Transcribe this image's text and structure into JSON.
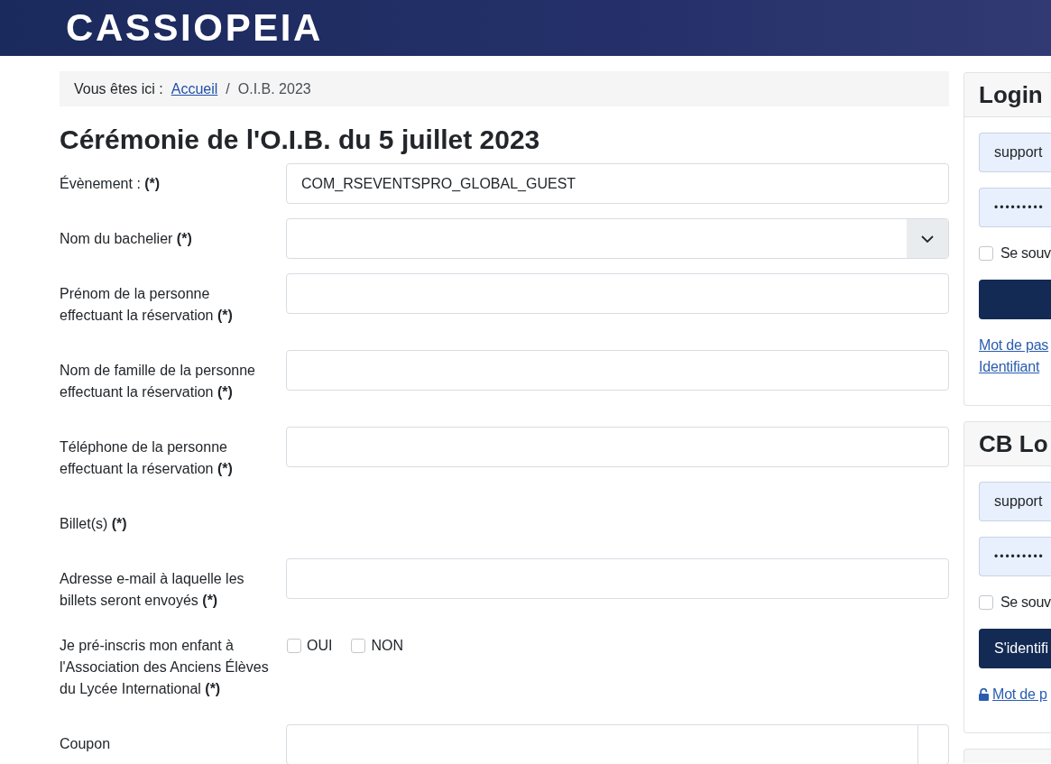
{
  "header": {
    "logo": "CASSIOPEIA"
  },
  "breadcrumb": {
    "prefix": "Vous êtes ici :",
    "separator": "/",
    "items": [
      {
        "label": "Accueil",
        "kind": "link"
      },
      {
        "label": "O.I.B. 2023",
        "kind": "current"
      }
    ]
  },
  "page_title": "Cérémonie de l'O.I.B. du 5 juillet 2023",
  "form": {
    "fields": [
      {
        "label": "Évènement : **(*)**",
        "kind": "text",
        "value": "COM_RSEVENTSPRO_GLOBAL_GUEST"
      },
      {
        "label": "Nom du bachelier **(*)**",
        "kind": "select"
      },
      {
        "label": "Prénom de la personne effectuant la réservation **(*)**",
        "kind": "text"
      },
      {
        "label": "Nom de famille de la personne effectuant la réservation **(*)**",
        "kind": "text"
      },
      {
        "label": "Téléphone de la personne effectuant la réservation **(*)**",
        "kind": "text"
      },
      {
        "label": "Billet(s) **(*)**",
        "kind": "none"
      },
      {
        "label": "Adresse e-mail à laquelle les billets seront envoyés **(*)**",
        "kind": "text"
      },
      {
        "label": "Je pré-inscris mon enfant à l'Association des Anciens Élèves du Lycée International **(*)**",
        "kind": "checkboxes",
        "options": [
          {
            "label": "OUI",
            "checked": false
          },
          {
            "label": "NON",
            "checked": false
          }
        ]
      },
      {
        "label": "Coupon",
        "kind": "coupon"
      }
    ]
  },
  "sidebar": {
    "modules": [
      {
        "title": "Login",
        "username": "support",
        "password": "•••••••••",
        "remember": {
          "label": "Se souv",
          "checked": false
        },
        "links": [
          {
            "label": "Mot de pas",
            "kind": "plain"
          },
          {
            "label": "Identifiant",
            "kind": "plain"
          }
        ]
      },
      {
        "title": "CB Lo",
        "username": "support",
        "password": "•••••••••",
        "remember": {
          "label": "Se souv",
          "checked": false
        },
        "button_label": "S'identifi",
        "links": [
          {
            "label": "Mot de p",
            "kind": "icon"
          }
        ]
      }
    ]
  }
}
